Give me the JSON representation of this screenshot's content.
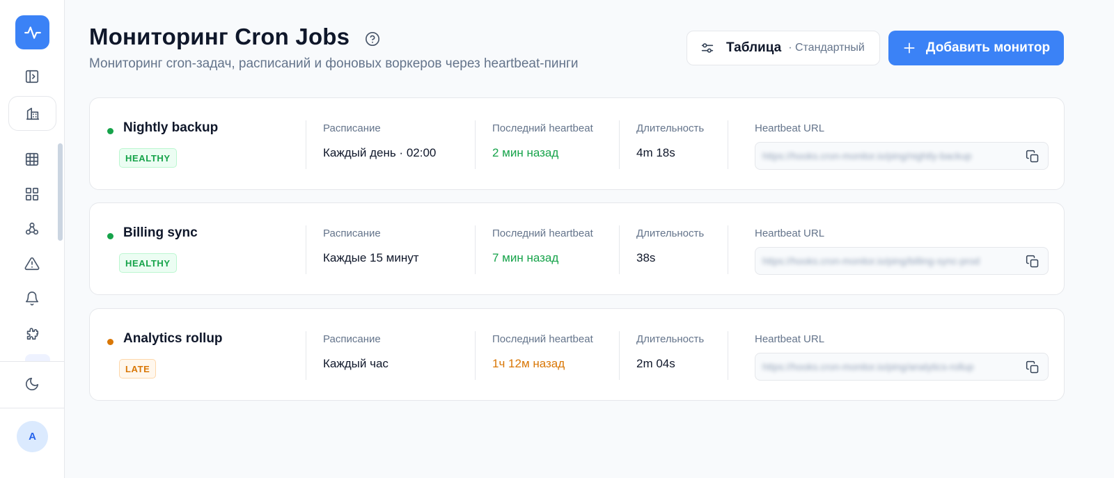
{
  "sidebar": {
    "avatar_initial": "A"
  },
  "header": {
    "title": "Мониторинг Cron Jobs",
    "subtitle": "Мониторинг cron-задач, расписаний и фоновых воркеров через heartbeat-пинги",
    "view_button": {
      "label": "Таблица",
      "mode": "· Стандартный"
    },
    "add_button": {
      "label": "Добавить монитор"
    }
  },
  "columns": {
    "schedule": "Расписание",
    "last_heartbeat": "Последний heartbeat",
    "duration": "Длительность",
    "heartbeat_url": "Heartbeat URL"
  },
  "monitors": [
    {
      "name": "Nightly backup",
      "status": "HEALTHY",
      "status_color": "#16a34a",
      "schedule": "Каждый день · 02:00",
      "last_heartbeat": "2 мин назад",
      "duration": "4m 18s",
      "url": "https://hooks.cron-monitor.io/ping/nightly-backup"
    },
    {
      "name": "Billing sync",
      "status": "HEALTHY",
      "status_color": "#16a34a",
      "schedule": "Каждые 15 минут",
      "last_heartbeat": "7 мин назад",
      "duration": "38s",
      "url": "https://hooks.cron-monitor.io/ping/billing-sync-prod"
    },
    {
      "name": "Analytics rollup",
      "status": "LATE",
      "status_color": "#d97706",
      "schedule": "Каждый час",
      "last_heartbeat": "1ч 12м назад",
      "duration": "2m 04s",
      "url": "https://hooks.cron-monitor.io/ping/analytics-rollup"
    }
  ],
  "colors": {
    "accent": "#3b82f6",
    "healthy": "#16a34a",
    "late": "#d97706"
  }
}
